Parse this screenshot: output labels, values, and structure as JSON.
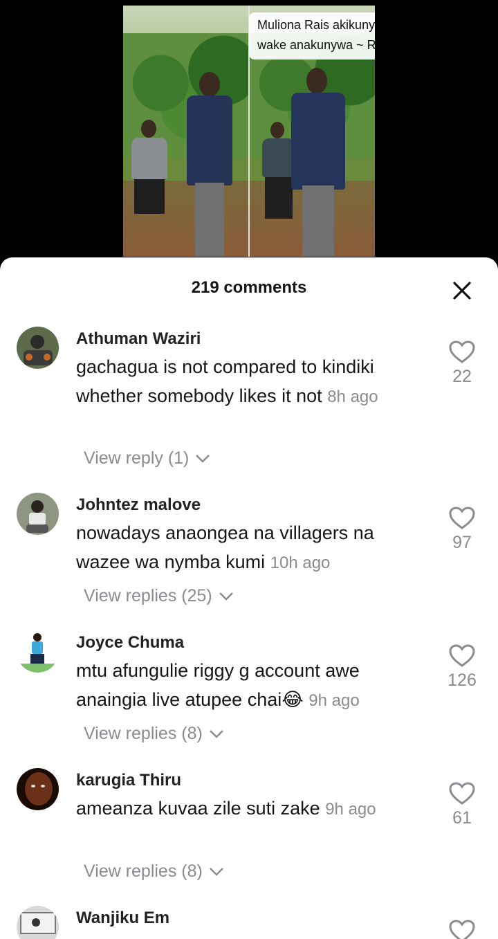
{
  "video": {
    "caption_line1": "Muliona Rais akikunywa maji, naibu",
    "caption_line2": "wake anakunywa ~ Riggy G 😂🤣"
  },
  "comments_sheet": {
    "title": "219 comments",
    "close_icon": "close-icon",
    "comments": [
      {
        "username": "Athuman Waziri",
        "text": "gachagua is not compared to kindiki whether somebody likes it not",
        "time": "8h ago",
        "likes": "22",
        "replies_label": "View reply (1)",
        "avatar_color": "#4a5a3a"
      },
      {
        "username": "Johntez malove",
        "text": "nowadays anaongea na villagers na wazee wa nymba kumi",
        "time": "10h ago",
        "likes": "97",
        "replies_label": "View replies (25)",
        "avatar_color": "#7a8570"
      },
      {
        "username": "Joyce Chuma",
        "text": "mtu afungulie riggy g account awe anaingia live atupee chai😂",
        "time": "9h ago",
        "likes": "126",
        "replies_label": "View replies (8)",
        "avatar_color": "#3aa8d8"
      },
      {
        "username": "karugia Thiru",
        "text": "ameanza kuvaa zile suti zake",
        "time": "9h ago",
        "likes": "61",
        "replies_label": "View replies (8)",
        "avatar_color": "#5a2a12"
      },
      {
        "username": "Wanjiku Em",
        "text": "",
        "time": "",
        "likes": "",
        "replies_label": "",
        "avatar_color": "#9a9a9a"
      }
    ]
  },
  "colors": {
    "sheet_bg": "#ffffff",
    "secondary_text": "#8a8b91",
    "primary_text": "#161616"
  }
}
